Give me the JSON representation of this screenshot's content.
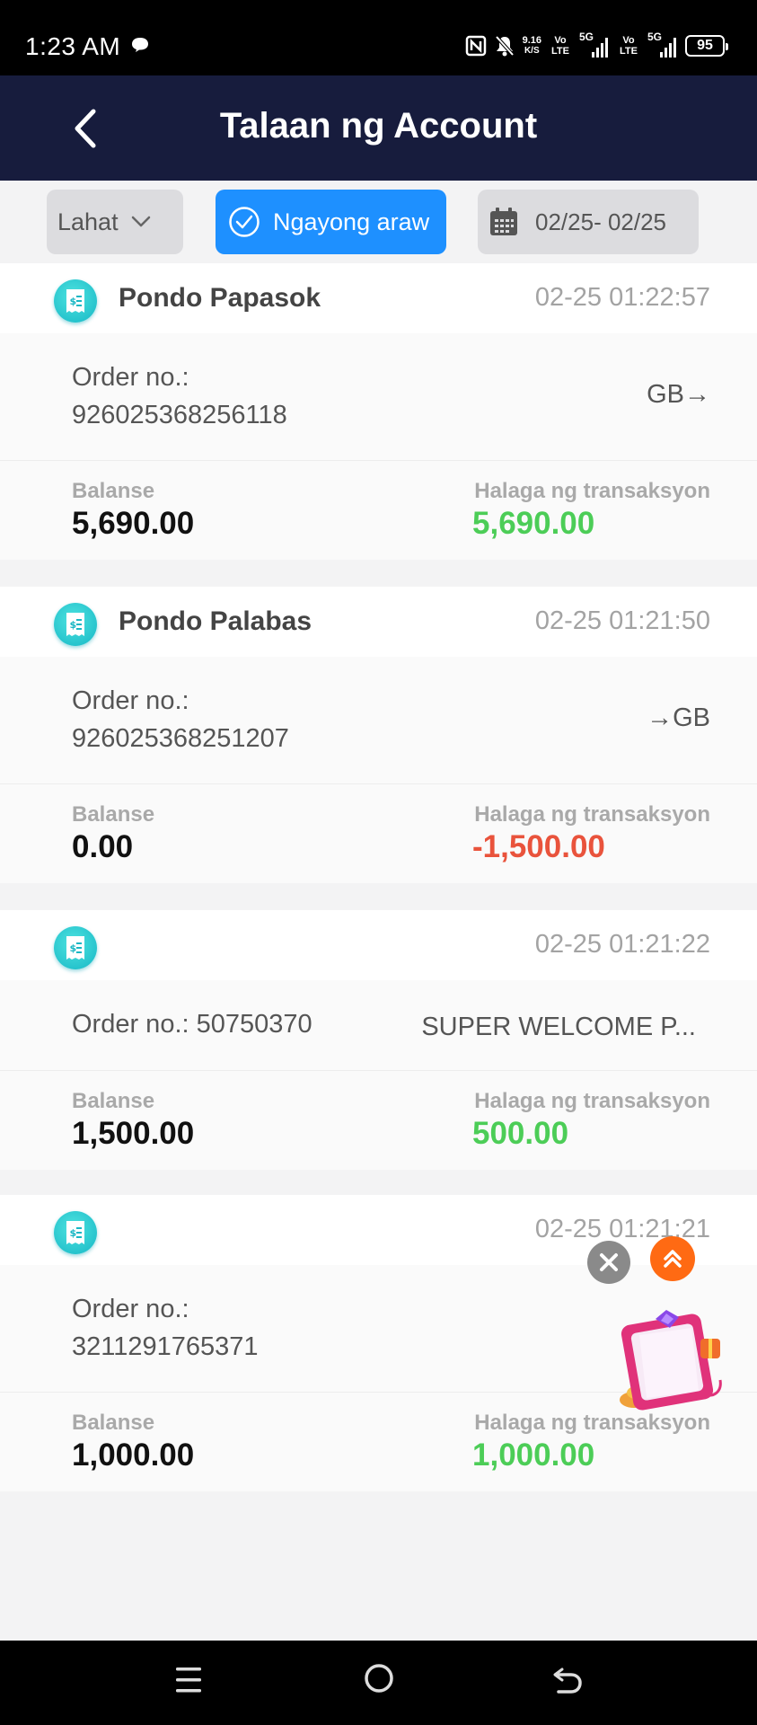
{
  "status_bar": {
    "time": "1:23 AM",
    "net_speed": "9.16",
    "net_speed_unit": "K/S",
    "volte1": "Vo LTE",
    "gen1": "5G",
    "volte2": "Vo LTE",
    "gen2": "5G",
    "battery": "95",
    "icons": [
      "message-icon",
      "nfc-icon",
      "bell-muted-icon",
      "signal-icon",
      "signal-icon"
    ]
  },
  "header": {
    "title": "Talaan ng Account",
    "back_icon": "chevron-left-icon"
  },
  "filters": {
    "type_label": "Lahat",
    "today_label": "Ngayong araw",
    "date_range": "02/25- 02/25"
  },
  "records": [
    {
      "title": "Pondo Papasok",
      "time": "02-25 01:22:57",
      "order_label": "Order no.:",
      "order_no": "926025368256118",
      "channel": "GB→",
      "balance_label": "Balanse",
      "balance": "5,690.00",
      "amount_label": "Halaga ng transaksyon",
      "amount": "5,690.00",
      "amount_color": "#4ccd57"
    },
    {
      "title": "Pondo Palabas",
      "time": "02-25 01:21:50",
      "order_label": "Order no.:",
      "order_no": "926025368251207",
      "channel": "→GB",
      "balance_label": "Balanse",
      "balance": "0.00",
      "amount_label": "Halaga ng transaksyon",
      "amount": "-1,500.00",
      "amount_color": "#e9533c"
    },
    {
      "title": "",
      "time": "02-25 01:21:22",
      "order_inline": "Order no.: 50750370",
      "channel": "SUPER WELCOME P...",
      "balance_label": "Balanse",
      "balance": "1,500.00",
      "amount_label": "Halaga ng transaksyon",
      "amount": "500.00",
      "amount_color": "#4ccd57"
    },
    {
      "title": "",
      "time": "02-25 01:21:21",
      "order_label": "Order no.:",
      "order_no": "3211291765371",
      "channel": "",
      "balance_label": "Balanse",
      "balance": "1,000.00",
      "amount_label": "Halaga ng transaksyon",
      "amount": "1,000.00",
      "amount_color": "#4ccd57"
    }
  ],
  "floating": {
    "close_icon": "close-icon",
    "top_icon": "double-chevron-up-icon",
    "promo_icon": "gift-box-icon"
  },
  "nav_bar": {
    "icons": [
      "menu-icon",
      "home-icon",
      "back-icon"
    ]
  },
  "colors": {
    "header_bg": "#171c3d",
    "accent_blue": "#1e90ff",
    "positive": "#4ccd57",
    "negative": "#e9533c",
    "fab_orange": "#ff6a13"
  }
}
